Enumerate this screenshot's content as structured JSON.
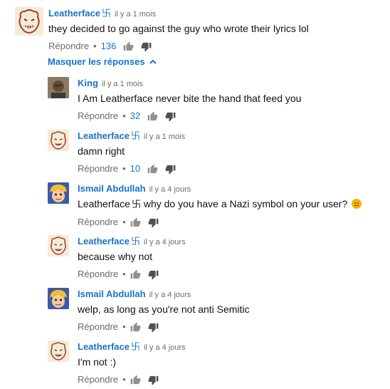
{
  "ui": {
    "reply_label": "Répondre",
    "separator": "•",
    "hide_replies": "Masquer les réponses",
    "swastika_glyph": "卐",
    "colors": {
      "link": "#1a73c8",
      "meta": "#6b6b6b",
      "text": "#111111"
    }
  },
  "comments": [
    {
      "author": "Leatherface",
      "has_symbol": true,
      "time": "il y a 1 mois",
      "text": "they decided to go against the guy who wrote their lyrics lol",
      "likes": "136",
      "avatar": "lion-avatar"
    },
    {
      "author": "King",
      "has_symbol": false,
      "time": "il y a 1 mois",
      "text": "I Am Leatherface never bite the hand that feed you",
      "likes": "32",
      "avatar": "portrait-avatar"
    },
    {
      "author": "Leatherface",
      "has_symbol": true,
      "time": "il y a 1 mois",
      "text": "damn right",
      "likes": "10",
      "avatar": "lion-avatar"
    },
    {
      "author": "Ismail Abdullah",
      "has_symbol": false,
      "time": "il y a 4 jours",
      "text_prefix": "Leatherface",
      "text_suffix": "why do you have a Nazi symbol on your user?",
      "likes": "",
      "avatar": "cartoon-avatar",
      "emoji": "worried-face-emoji"
    },
    {
      "author": "Leatherface",
      "has_symbol": true,
      "time": "il y a 4 jours",
      "text": "because why not",
      "likes": "",
      "avatar": "lion-avatar"
    },
    {
      "author": "Ismail Abdullah",
      "has_symbol": false,
      "time": "il y a 4 jours",
      "text": "welp, as long as you're not anti Semitic",
      "likes": "",
      "avatar": "cartoon-avatar"
    },
    {
      "author": "Leatherface",
      "has_symbol": true,
      "time": "il y a 4 jours",
      "text": "I'm not :)",
      "likes": "",
      "avatar": "lion-avatar"
    }
  ]
}
